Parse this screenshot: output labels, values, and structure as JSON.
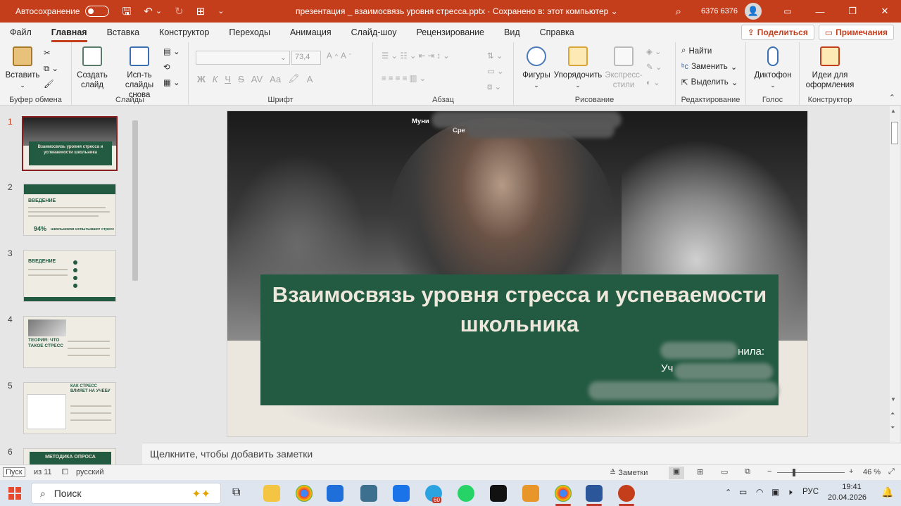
{
  "titlebar": {
    "autosave_label": "Автосохранение",
    "doc_title": "презентация _ взаимосвязь  уровня стресса.pptx  ·  Сохранено в: этот компьютер  ⌄",
    "user_name": "6376 6376",
    "bg_color": "#c43e1c"
  },
  "menu": {
    "tabs": [
      "Файл",
      "Главная",
      "Вставка",
      "Конструктор",
      "Переходы",
      "Анимация",
      "Слайд-шоу",
      "Рецензирование",
      "Вид",
      "Справка"
    ],
    "active": "Главная",
    "share_label": "Поделиться",
    "comments_label": "Примечания"
  },
  "ribbon": {
    "clipboard": {
      "paste": "Вставить",
      "group": "Буфер обмена"
    },
    "slides": {
      "new_slide": "Создать слайд",
      "reuse": "Исп-ть слайды снова",
      "group": "Слайды"
    },
    "font": {
      "size": "73,4",
      "group": "Шрифт",
      "bold": "Ж",
      "italic": "К",
      "underline": "Ч",
      "strike": "S",
      "case": "Аа",
      "spacing": "AV"
    },
    "paragraph": {
      "group": "Абзац"
    },
    "drawing": {
      "shapes": "Фигуры",
      "arrange": "Упорядочить",
      "styles": "Экспресс-стили",
      "group": "Рисование"
    },
    "editing": {
      "find": "Найти",
      "replace": "Заменить",
      "select": "Выделить",
      "group": "Редактирование"
    },
    "voice": {
      "dictate": "Диктофон",
      "group": "Голос"
    },
    "designer": {
      "ideas": "Идеи для оформления",
      "group": "Конструктор"
    }
  },
  "thumbnails": [
    {
      "num": "1",
      "title": "Взаимосвязь уровня стресса и успеваемости школьника",
      "selected": true
    },
    {
      "num": "2",
      "title": "ВВЕДЕНИЕ",
      "stat": "94%",
      "stat_caption": "школьников испытывают стресс"
    },
    {
      "num": "3",
      "title": "ВВЕДЕНИЕ"
    },
    {
      "num": "4",
      "title": "ТЕОРИЯ: ЧТО ТАКОЕ СТРЕСС"
    },
    {
      "num": "5",
      "title": "КАК СТРЕСС ВЛИЯЕТ НА УЧЕБУ"
    },
    {
      "num": "6",
      "title": "МЕТОДИКА ОПРОСА"
    }
  ],
  "slide": {
    "org_line1": "Муни",
    "org_line2": "Сре",
    "title": "Взаимосвязь уровня стресса и успеваемости школьника",
    "author_label": "нила:",
    "author_line2": "Уч",
    "accent_color": "#235a42"
  },
  "notes_placeholder": "Щелкните, чтобы добавить заметки",
  "status": {
    "slide_info": "Пуск",
    "slide_of": "из 11",
    "language": "русский",
    "notes_btn": "Заметки",
    "zoom": "46 %"
  },
  "taskbar": {
    "search_placeholder": "Поиск",
    "lang": "РУС",
    "time": "19:41",
    "date": "20.04.2026",
    "telegram_badge": "60"
  }
}
